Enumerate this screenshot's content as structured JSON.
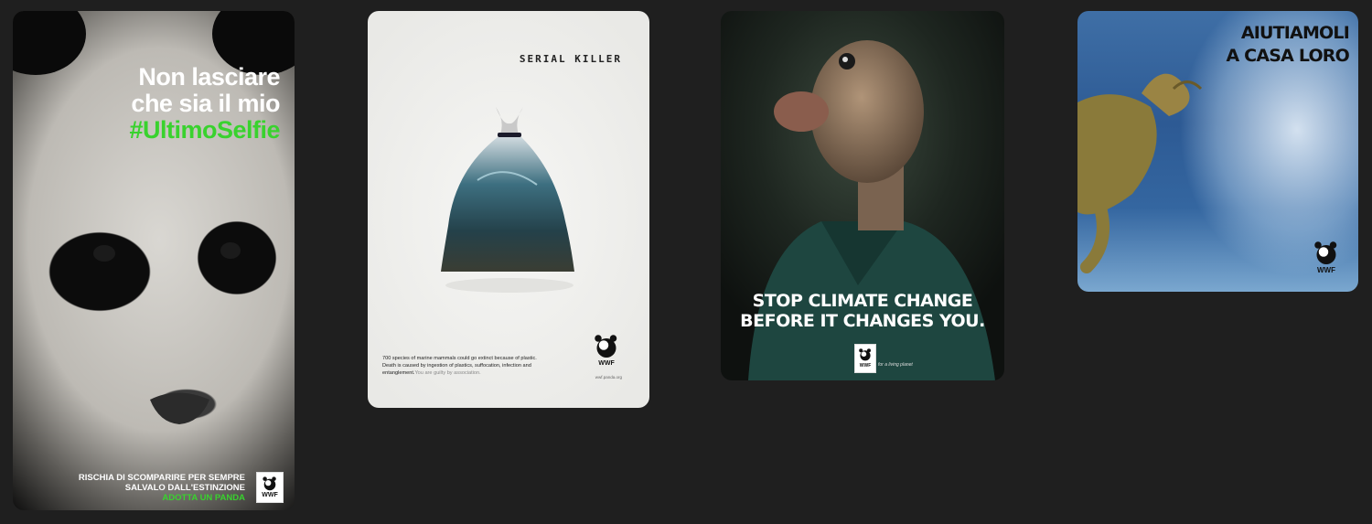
{
  "panda_card": {
    "headline_line1": "Non lasciare",
    "headline_line2": "che sia il mio",
    "headline_hashtag": "#UltimoSelfie",
    "footer_line1": "RISCHIA DI SCOMPARIRE PER SEMPRE",
    "footer_line2": "SALVALO DALL'ESTINZIONE",
    "footer_cta": "ADOTTA UN PANDA",
    "logo_text": "WWF",
    "accent_color": "#39d22e"
  },
  "serial_card": {
    "title": "SERIAL KILLER",
    "body_line1": "700 species of marine mammals could go extinct because of plastic.",
    "body_line2": "Death is caused by ingestion of plastics, suffocation, infection and",
    "body_line3": "entanglement.",
    "body_grey": "You are guilty by association.",
    "url": "wwf.panda.org",
    "logo_text": "WWF"
  },
  "climate_card": {
    "headline_line1": "STOP CLIMATE CHANGE",
    "headline_line2": "BEFORE IT CHANGES YOU.",
    "logo_text": "WWF",
    "tagline": "for a living planet"
  },
  "turtle_card": {
    "headline_line1": "AIUTIAMOLI",
    "headline_line2": "A CASA LORO",
    "logo_text": "WWF"
  }
}
